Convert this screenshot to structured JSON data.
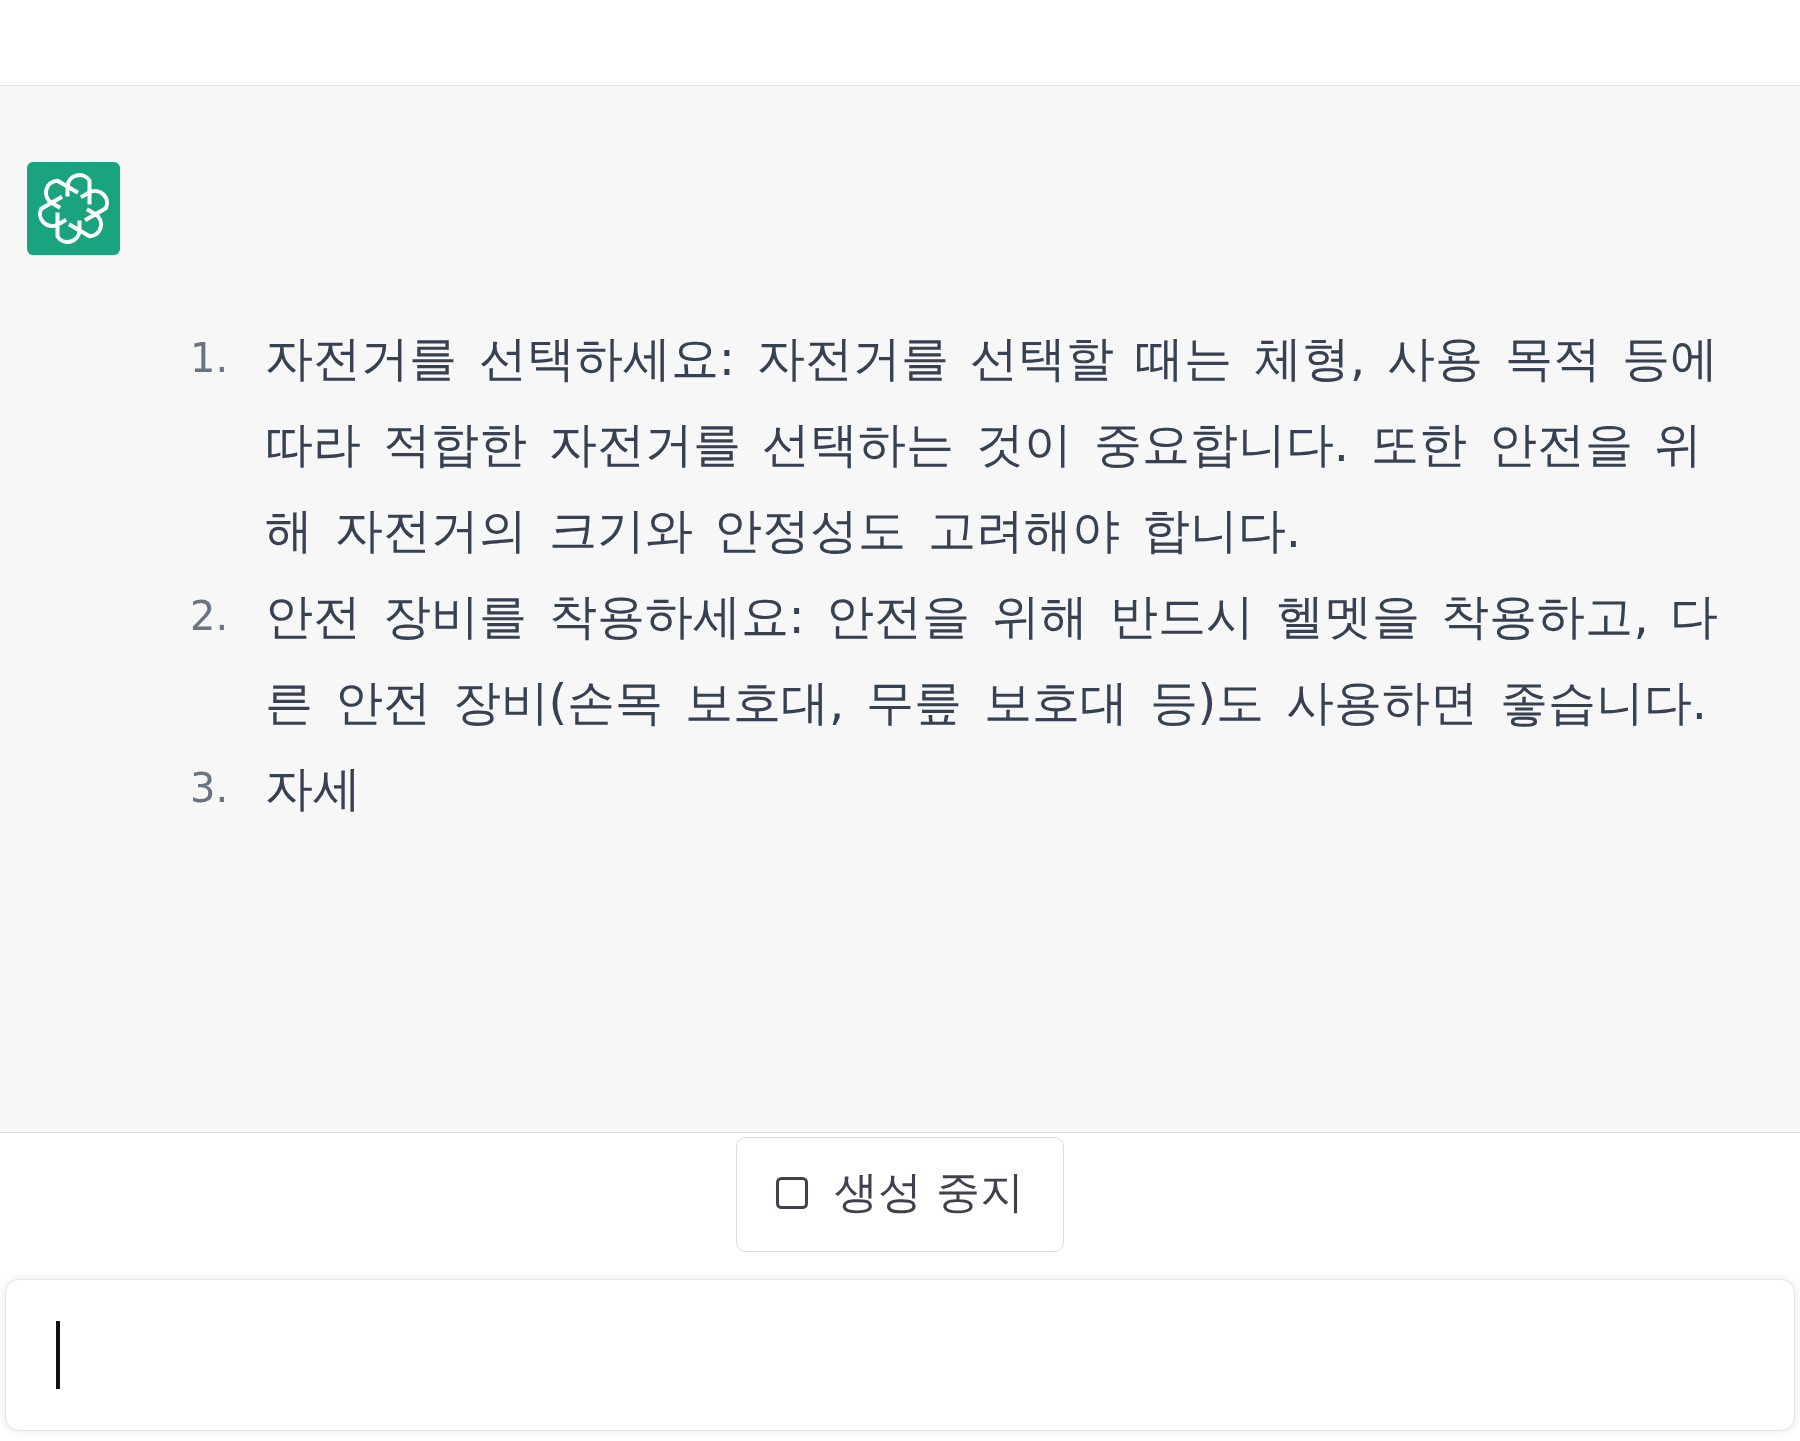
{
  "response": {
    "items": [
      {
        "number": "1.",
        "text": "자전거를 선택하세요: 자전거를 선택할 때는 체형, 사용 목적 등에 따라 적합한 자전거를 선택하는 것이 중요합니다. 또한 안전을 위해 자전거의 크기와 안정성도 고려해야 합니다."
      },
      {
        "number": "2.",
        "text": "안전 장비를 착용하세요: 안전을 위해 반드시 헬멧을 착용하고, 다른 안전 장비(손목 보호대, 무릎 보호대 등)도 사용하면 좋습니다."
      },
      {
        "number": "3.",
        "text": "자세"
      }
    ]
  },
  "stop_button": {
    "label": "생성 중지"
  }
}
